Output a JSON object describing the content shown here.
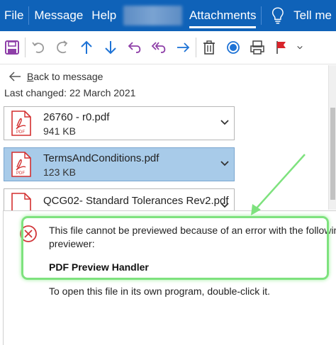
{
  "menubar": {
    "file": "File",
    "message": "Message",
    "help": "Help",
    "attachments": "Attachments",
    "tell_me": "Tell me"
  },
  "toolbar": {
    "buttons": [
      "save-icon",
      "undo-icon",
      "redo-icon",
      "up-arrow-icon",
      "down-arrow-icon",
      "reply-icon",
      "reply-all-icon",
      "forward-icon",
      "delete-icon",
      "circle-icon",
      "print-icon",
      "flag-icon",
      "more-icon"
    ]
  },
  "nav": {
    "back_label": "Back to message",
    "last_changed_label": "Last changed:",
    "last_changed_value": "22 March 2021"
  },
  "attachments": [
    {
      "name": "26760 - r0.pdf",
      "size": "941 KB",
      "selected": false
    },
    {
      "name": "TermsAndConditions.pdf",
      "size": "123 KB",
      "selected": true
    },
    {
      "name": "QCG02- Standard Tolerances Rev2.pdf",
      "size": "",
      "selected": false
    }
  ],
  "preview": {
    "error_line1": "This file cannot be previewed because of an error with the following",
    "error_line2": "previewer:",
    "handler": "PDF Preview Handler",
    "open_hint": "To open this file in its own program, double-click it."
  },
  "colors": {
    "ribbon": "#0f62b8",
    "selected_attachment": "#a8cbe9",
    "pdf_red": "#d32f2f",
    "annotation_green": "#7ee27e",
    "error_red": "#d13438"
  }
}
